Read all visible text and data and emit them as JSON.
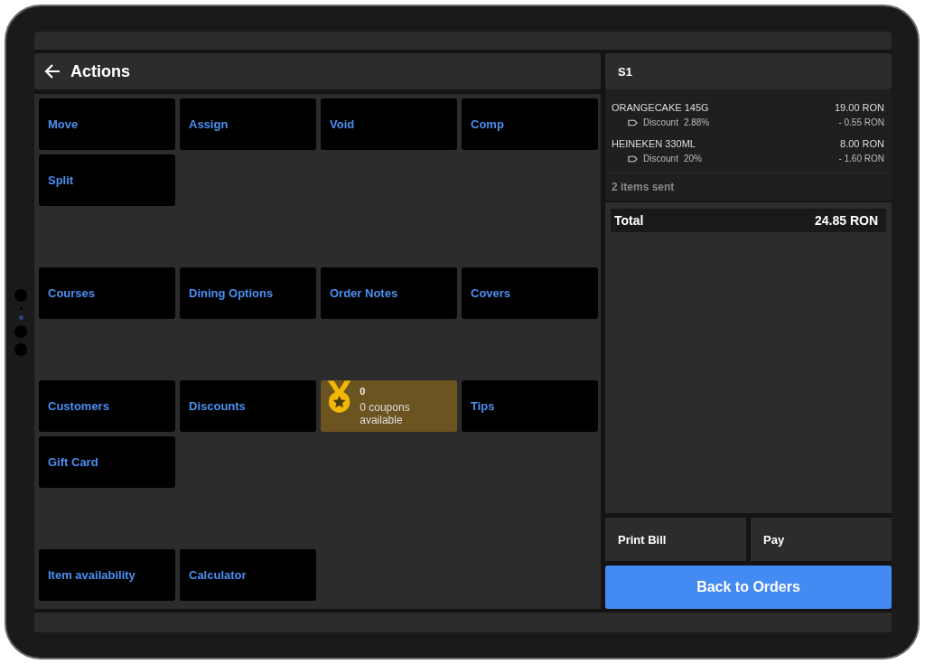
{
  "header": {
    "title": "Actions"
  },
  "action_groups": [
    {
      "buttons": [
        {
          "kind": "action",
          "label": "Move"
        },
        {
          "kind": "action",
          "label": "Assign"
        },
        {
          "kind": "action",
          "label": "Void"
        },
        {
          "kind": "action",
          "label": "Comp"
        },
        {
          "kind": "action",
          "label": "Split"
        }
      ]
    },
    {
      "buttons": [
        {
          "kind": "action",
          "label": "Courses"
        },
        {
          "kind": "action",
          "label": "Dining Options"
        },
        {
          "kind": "action",
          "label": "Order Notes"
        },
        {
          "kind": "action",
          "label": "Covers"
        }
      ]
    },
    {
      "buttons": [
        {
          "kind": "action",
          "label": "Customers"
        },
        {
          "kind": "action",
          "label": "Discounts"
        },
        {
          "kind": "coupon",
          "label": "0",
          "sublabel": "0 coupons available"
        },
        {
          "kind": "action",
          "label": "Tips"
        },
        {
          "kind": "action",
          "label": "Gift Card"
        }
      ]
    },
    {
      "buttons": [
        {
          "kind": "action",
          "label": "Item availability"
        },
        {
          "kind": "action",
          "label": "Calculator"
        }
      ]
    }
  ],
  "order": {
    "title": "S1",
    "items": [
      {
        "name": "ORANGECAKE 145G",
        "price": "19.00 RON",
        "discount_label": "Discount",
        "discount_rate": "2.88%",
        "discount_amount": "- 0.55 RON"
      },
      {
        "name": "HEINEKEN 330ML",
        "price": "8.00 RON",
        "discount_label": "Discount",
        "discount_rate": "20%",
        "discount_amount": "- 1.60 RON"
      }
    ],
    "sent_note": "2 items sent",
    "total_label": "Total",
    "total_value": "24.85 RON"
  },
  "buttons": {
    "print": "Print Bill",
    "pay": "Pay",
    "back": "Back to Orders"
  }
}
